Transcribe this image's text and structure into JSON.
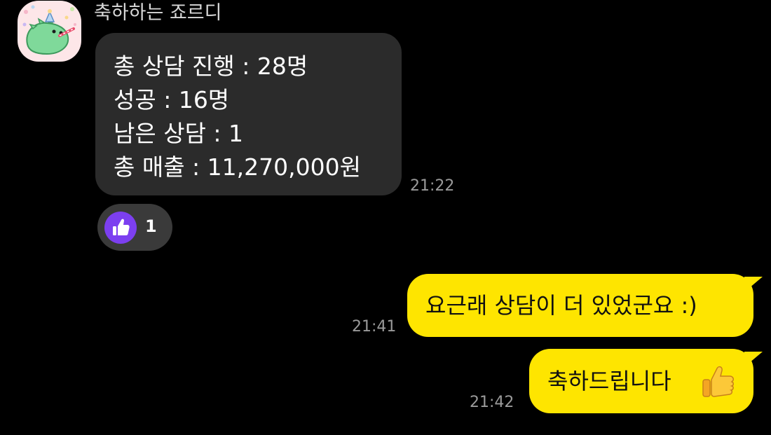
{
  "chat": {
    "sender_name": "축하하는 죠르디",
    "incoming_message": {
      "lines": [
        "총 상담 진행 : 28명",
        "성공 : 16명",
        "남은 상담 : 1",
        "총 매출 : 11,270,000원"
      ],
      "time": "21:22",
      "reaction": {
        "icon": "thumbs-up-icon",
        "count": "1",
        "color": "#7c3ff0"
      }
    },
    "outgoing_messages": [
      {
        "text": "요근래 상담이 더 있었군요 :)",
        "time": "21:41"
      },
      {
        "text": "축하드립니다",
        "emoji": "thumbs-up-emoji",
        "time": "21:42"
      }
    ]
  },
  "colors": {
    "background": "#000000",
    "incoming_bubble": "#2b2b2b",
    "outgoing_bubble": "#fee500"
  }
}
